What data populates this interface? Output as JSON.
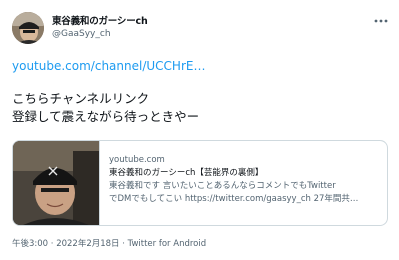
{
  "author": {
    "display_name": "東谷義和のガーシーch",
    "handle": "@GaaSyy_ch"
  },
  "menu": {
    "more_icon": "more-horizontal-icon"
  },
  "tweet": {
    "link_text": "youtube.com/channel/UCCHrE…",
    "text_line_1": "こちらチャンネルリンク",
    "text_line_2": "登録して震えながら待っときやー"
  },
  "card": {
    "domain": "youtube.com",
    "title": "東谷義和のガーシーch【芸能界の裏側】",
    "desc_line_1": "東谷義和です 言いたいことあるんならコメントでもTwitter",
    "desc_line_2": "でDMでもしてこい https://twitter.com/gaasyy_ch 27年間共…"
  },
  "meta": {
    "time": "午後3:00",
    "separator_1": " · ",
    "date": "2022年2月18日",
    "separator_2": " · ",
    "client": "Twitter for Android"
  },
  "colors": {
    "link": "#1d9bf0",
    "secondary_text": "#536471",
    "border": "#cfd9de"
  }
}
